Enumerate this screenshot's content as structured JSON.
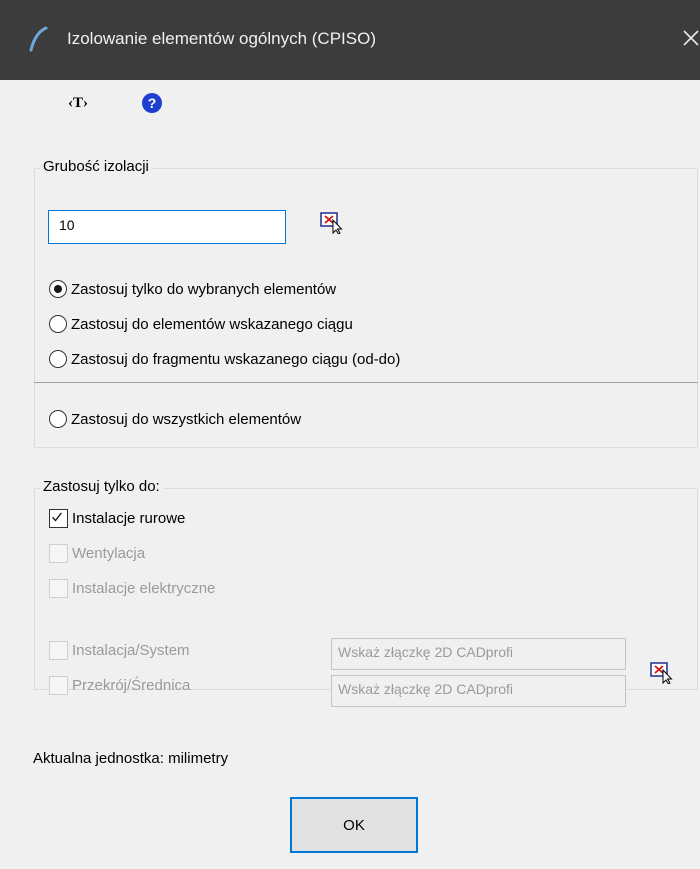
{
  "window": {
    "title": "Izolowanie elementów ogólnych (CPISO)",
    "icon": "cadprofi-app-icon",
    "close_icon": "close-icon"
  },
  "toolbar": {
    "text_button_label": "‹T›",
    "help_icon": "help-icon"
  },
  "thickness_group": {
    "title": "Grubość izolacji",
    "value": "10",
    "pick_button_icon": "pick-from-drawing-icon",
    "radios": [
      {
        "label": "Zastosuj tylko do wybranych elementów",
        "checked": true
      },
      {
        "label": "Zastosuj do elementów wskazanego ciągu",
        "checked": false
      },
      {
        "label": "Zastosuj do fragmentu wskazanego ciągu (od-do)",
        "checked": false
      },
      {
        "label": "Zastosuj do wszystkich elementów",
        "checked": false
      }
    ]
  },
  "filter_group": {
    "title": "Zastosuj tylko do:",
    "checkboxes": [
      {
        "label": "Instalacje rurowe",
        "checked": true,
        "enabled": true
      },
      {
        "label": "Wentylacja",
        "checked": false,
        "enabled": false
      },
      {
        "label": "Instalacje elektryczne",
        "checked": false,
        "enabled": false
      },
      {
        "label": "Instalacja/System",
        "checked": false,
        "enabled": false
      },
      {
        "label": "Przekrój/Średnica",
        "checked": false,
        "enabled": false
      }
    ],
    "system_placeholder": "Wskaż złączkę 2D CADprofi",
    "section_placeholder": "Wskaż złączkę 2D CADprofi",
    "pick_button_icon": "pick-from-drawing-icon"
  },
  "status": {
    "text": "Aktualna jednostka: milimetry"
  },
  "footer": {
    "ok_label": "OK"
  }
}
